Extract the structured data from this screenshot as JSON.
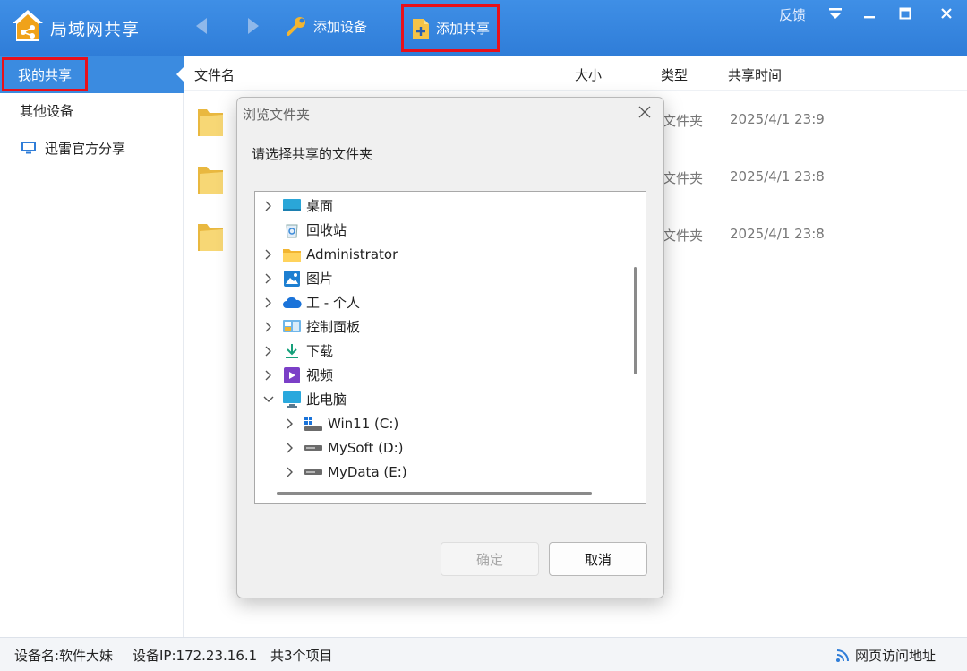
{
  "app": {
    "title": "局域网共享"
  },
  "toolbar": {
    "add_device": "添加设备",
    "add_share": "添加共享",
    "feedback": "反馈"
  },
  "sidebar": {
    "items": [
      {
        "label": "我的共享"
      },
      {
        "label": "其他设备"
      },
      {
        "label": "迅雷官方分享"
      }
    ]
  },
  "list": {
    "columns": {
      "name": "文件名",
      "size": "大小",
      "type": "类型",
      "time": "共享时间"
    },
    "rows": [
      {
        "type": "文件夹",
        "time": "2025/4/1 23:9"
      },
      {
        "type": "文件夹",
        "time": "2025/4/1 23:8"
      },
      {
        "type": "文件夹",
        "time": "2025/4/1 23:8"
      }
    ]
  },
  "statusbar": {
    "device_name": "设备名:软件大妹",
    "device_ip": "设备IP:172.23.16.1",
    "count": "共3个项目",
    "web_access": "网页访问地址"
  },
  "dialog": {
    "title": "浏览文件夹",
    "prompt": "请选择共享的文件夹",
    "tree": [
      {
        "label": "桌面",
        "icon": "desktop-icon",
        "expandable": true
      },
      {
        "label": "回收站",
        "icon": "recycle-bin-icon",
        "expandable": false
      },
      {
        "label": "Administrator",
        "icon": "folder-icon",
        "expandable": true
      },
      {
        "label": "图片",
        "icon": "pictures-icon",
        "expandable": true
      },
      {
        "label": "工 - 个人",
        "icon": "onedrive-icon",
        "expandable": true
      },
      {
        "label": "控制面板",
        "icon": "control-panel-icon",
        "expandable": true
      },
      {
        "label": "下载",
        "icon": "download-icon",
        "expandable": true
      },
      {
        "label": "视频",
        "icon": "video-icon",
        "expandable": true
      },
      {
        "label": "此电脑",
        "icon": "this-pc-icon",
        "expandable": true,
        "expanded": true
      },
      {
        "label": "Win11 (C:)",
        "icon": "windows-drive-icon",
        "expandable": true
      },
      {
        "label": "MySoft (D:)",
        "icon": "drive-icon",
        "expandable": true
      },
      {
        "label": "MyData (E:)",
        "icon": "drive-icon",
        "expandable": true
      }
    ],
    "ok": "确定",
    "cancel": "取消"
  },
  "colors": {
    "titlebar": "#2f7dd8",
    "selection": "#3b8be0",
    "highlight_box": "#e8101a"
  }
}
